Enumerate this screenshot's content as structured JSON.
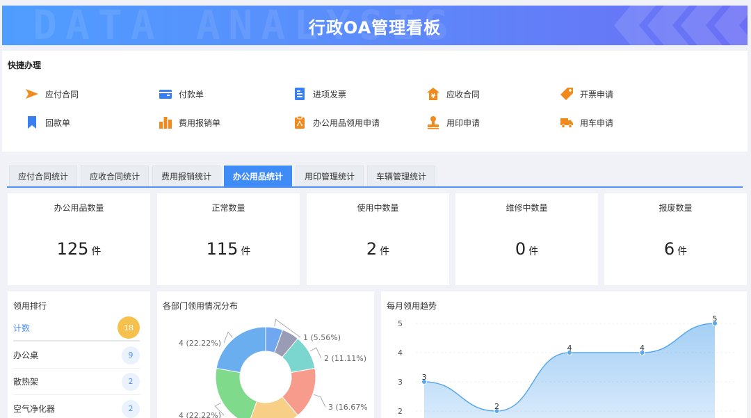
{
  "header": {
    "title": "行政OA管理看板",
    "bg_text": "DATA ANALYSIS"
  },
  "quick": {
    "title": "快捷办理",
    "items": [
      {
        "label": "应付合同",
        "icon": "send-icon",
        "color": "#f08a1c"
      },
      {
        "label": "付款单",
        "icon": "wallet-icon",
        "color": "#3a7ff0"
      },
      {
        "label": "进项发票",
        "icon": "document-icon",
        "color": "#3a7ff0"
      },
      {
        "label": "应收合同",
        "icon": "yen-house-icon",
        "color": "#f08a1c"
      },
      {
        "label": "开票申请",
        "icon": "tag-icon",
        "color": "#f08a1c"
      },
      {
        "label": "回款单",
        "icon": "bookmark-icon",
        "color": "#3a7ff0"
      },
      {
        "label": "费用报销单",
        "icon": "bar-chart-icon",
        "color": "#f08a1c"
      },
      {
        "label": "办公用品领用申请",
        "icon": "clipboard-icon",
        "color": "#f08a1c"
      },
      {
        "label": "用印申请",
        "icon": "stamp-icon",
        "color": "#f08a1c"
      },
      {
        "label": "用车申请",
        "icon": "truck-icon",
        "color": "#f08a1c"
      }
    ]
  },
  "tabs": [
    {
      "label": "应付合同统计",
      "active": false
    },
    {
      "label": "应收合同统计",
      "active": false
    },
    {
      "label": "费用报销统计",
      "active": false
    },
    {
      "label": "办公用品统计",
      "active": true
    },
    {
      "label": "用印管理统计",
      "active": false
    },
    {
      "label": "车辆管理统计",
      "active": false
    }
  ],
  "stats": [
    {
      "label": "办公用品数量",
      "value": "125",
      "unit": "件"
    },
    {
      "label": "正常数量",
      "value": "115",
      "unit": "件"
    },
    {
      "label": "使用中数量",
      "value": "2",
      "unit": "件"
    },
    {
      "label": "维修中数量",
      "value": "0",
      "unit": "件"
    },
    {
      "label": "报废数量",
      "value": "6",
      "unit": "件"
    }
  ],
  "ranking": {
    "title": "领用排行",
    "header": {
      "name": "计数",
      "count": "18"
    },
    "rows": [
      {
        "name": "办公桌",
        "count": "9"
      },
      {
        "name": "散热架",
        "count": "2"
      },
      {
        "name": "空气净化器",
        "count": "2"
      }
    ]
  },
  "chart_data": [
    {
      "type": "pie",
      "title": "各部门领用情况分布",
      "slices": [
        {
          "value": 1,
          "label": "1 (5.56%)",
          "color": "#6fa8f0"
        },
        {
          "value": 1,
          "label": "",
          "color": "#9a9bb5"
        },
        {
          "value": 2,
          "label": "2 (11.11%)",
          "color": "#7ad6cf"
        },
        {
          "value": 3,
          "label": "3 (16.67%",
          "color": "#f79c8c"
        },
        {
          "value": 3,
          "label": "",
          "color": "#f7cf86"
        },
        {
          "value": 4,
          "label": "4 (22.22%)",
          "color": "#7fdb8b"
        },
        {
          "value": 4,
          "label": "4 (22.22%)",
          "color": "#6aaef0"
        }
      ]
    },
    {
      "type": "area",
      "title": "每月领用趋势",
      "y_ticks": [
        "2",
        "3",
        "4",
        "5"
      ],
      "values": [
        3,
        2,
        4,
        4,
        5
      ],
      "value_labels": [
        "3",
        "2",
        "4",
        "4",
        "5"
      ],
      "ylim": [
        1,
        5
      ],
      "grid": true,
      "color": "#5aa8ec"
    }
  ]
}
